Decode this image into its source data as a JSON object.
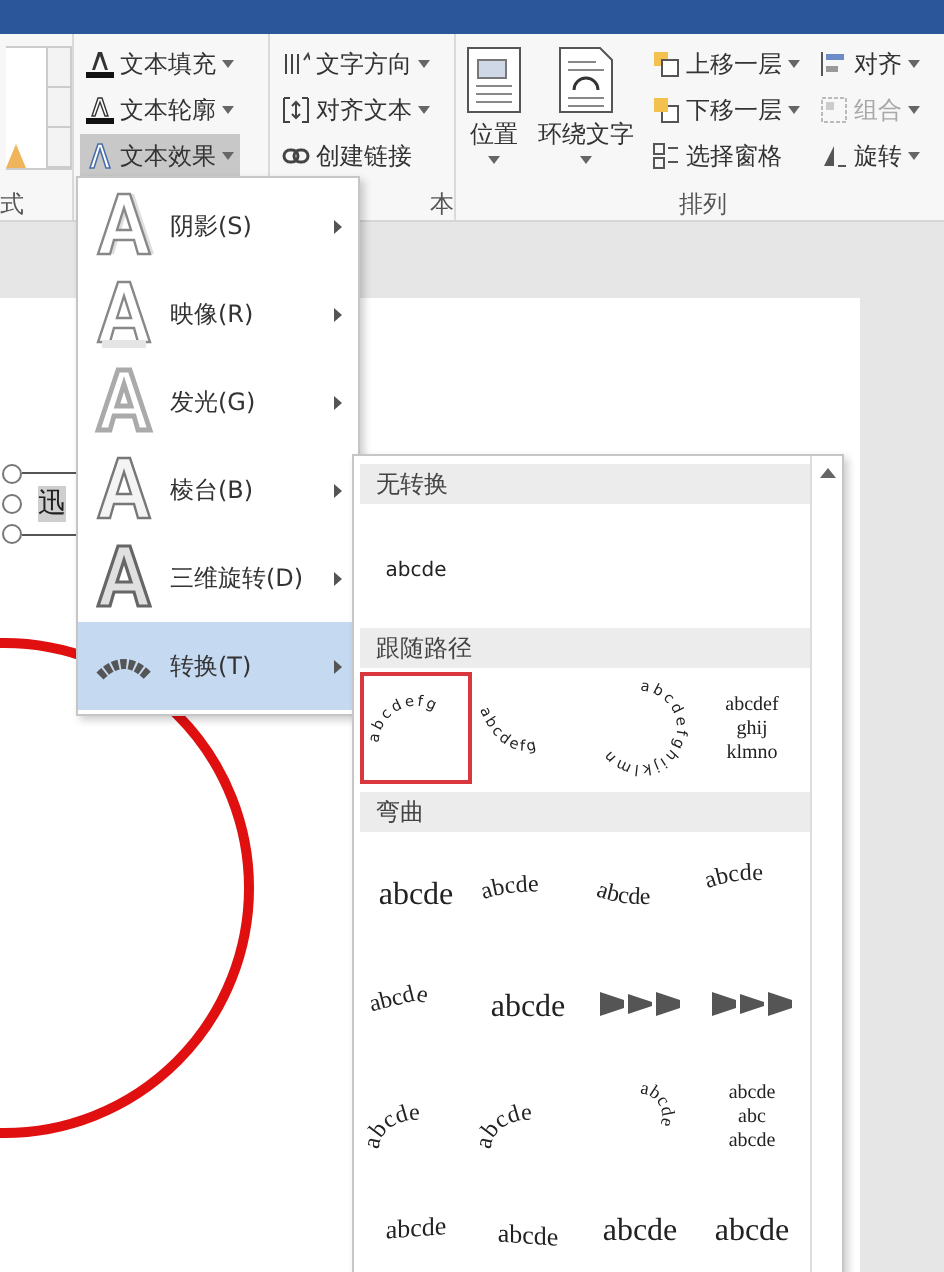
{
  "ribbon": {
    "groups": [
      {
        "kind": "gallery",
        "label": "式"
      },
      {
        "kind": "commands",
        "items": [
          {
            "kind": "fill",
            "label": "文本填充",
            "dropdown": true,
            "pressed": false,
            "disabled": false
          },
          {
            "kind": "outline",
            "label": "文本轮廓",
            "dropdown": true,
            "pressed": false,
            "disabled": false
          },
          {
            "kind": "effects",
            "label": "文本效果",
            "dropdown": true,
            "pressed": true,
            "disabled": false
          }
        ]
      },
      {
        "kind": "commands",
        "label": "本",
        "items": [
          {
            "kind": "direction",
            "label": "文字方向",
            "dropdown": true,
            "pressed": false,
            "disabled": false
          },
          {
            "kind": "align",
            "label": "对齐文本",
            "dropdown": true,
            "pressed": false,
            "disabled": false
          },
          {
            "kind": "link",
            "label": "创建链接",
            "dropdown": false,
            "pressed": false,
            "disabled": false
          }
        ]
      },
      {
        "kind": "arrange",
        "label": "排列",
        "large": [
          {
            "kind": "position",
            "label": "位置"
          },
          {
            "kind": "wrap",
            "label": "环绕文字"
          }
        ],
        "items": [
          {
            "kind": "forward",
            "label": "上移一层",
            "dropdown": true,
            "pressed": false,
            "disabled": false
          },
          {
            "kind": "backward",
            "label": "下移一层",
            "dropdown": true,
            "pressed": false,
            "disabled": false
          },
          {
            "kind": "pane",
            "label": "选择窗格",
            "dropdown": false,
            "pressed": false,
            "disabled": false
          },
          {
            "kind": "align-objects",
            "label": "对齐",
            "dropdown": true,
            "pressed": false,
            "disabled": false
          },
          {
            "kind": "group",
            "label": "组合",
            "dropdown": true,
            "pressed": false,
            "disabled": true
          },
          {
            "kind": "rotate",
            "label": "旋转",
            "dropdown": true,
            "pressed": false,
            "disabled": false
          }
        ]
      }
    ]
  },
  "document": {
    "textbox_text": "迅"
  },
  "effects_menu": [
    {
      "kind": "shadow",
      "label": "阴影(S)",
      "selected": false
    },
    {
      "kind": "reflection",
      "label": "映像(R)",
      "selected": false
    },
    {
      "kind": "glow",
      "label": "发光(G)",
      "selected": false
    },
    {
      "kind": "bevel",
      "label": "棱台(B)",
      "selected": false
    },
    {
      "kind": "rotation",
      "label": "三维旋转(D)",
      "selected": false
    },
    {
      "kind": "transform",
      "label": "转换(T)",
      "selected": true
    }
  ],
  "transform_gallery": [
    {
      "title": "无转换",
      "items": [
        {
          "kind": "plain-small",
          "text": "abcde",
          "selected": false
        }
      ]
    },
    {
      "title": "跟随路径",
      "items": [
        {
          "kind": "arc",
          "text": "abcdefg",
          "selected": true
        },
        {
          "kind": "smile",
          "text": "abcdefg",
          "selected": false
        },
        {
          "kind": "circle",
          "text": "abcdefghijklmn",
          "selected": false
        },
        {
          "kind": "button",
          "lines": [
            "abcdef",
            "ghij",
            "klmno"
          ],
          "selected": false
        }
      ]
    },
    {
      "title": "弯曲",
      "items": [
        {
          "kind": "plain",
          "text": "abcde",
          "selected": false
        },
        {
          "kind": "wave",
          "text": "abcde",
          "selected": false
        },
        {
          "kind": "dip",
          "text": "abcde",
          "selected": false
        },
        {
          "kind": "rise",
          "text": "abcde",
          "selected": false
        },
        {
          "kind": "chevron",
          "text": "abcde",
          "selected": false
        },
        {
          "kind": "plain",
          "text": "abcde",
          "selected": false
        },
        {
          "kind": "pinch",
          "selected": false
        },
        {
          "kind": "pinch",
          "selected": false
        },
        {
          "kind": "arch",
          "text": "abcde",
          "selected": false
        },
        {
          "kind": "arch",
          "text": "abcde",
          "selected": false
        },
        {
          "kind": "circle",
          "text": "abcde",
          "selected": false
        },
        {
          "kind": "button",
          "lines": [
            "abcde",
            "abc",
            "abcde"
          ],
          "selected": false
        },
        {
          "kind": "fade-up",
          "text": "abcde",
          "selected": false
        },
        {
          "kind": "fade-down",
          "text": "abcde",
          "selected": false
        },
        {
          "kind": "plain",
          "text": "abcde",
          "selected": false
        },
        {
          "kind": "plain",
          "text": "abcde",
          "selected": false
        }
      ]
    }
  ]
}
